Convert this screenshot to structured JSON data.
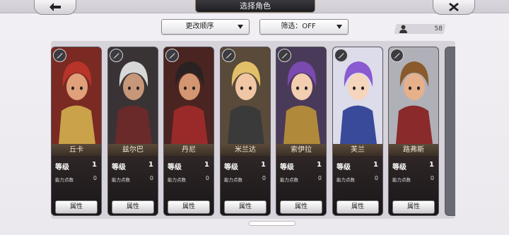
{
  "header": {
    "title": "选择角色"
  },
  "filters": {
    "sort_label": "更改顺序",
    "filter_label": "筛选：OFF"
  },
  "roster": {
    "count": "58"
  },
  "labels": {
    "level": "等级",
    "ability_points": "能力点数",
    "attribute_button": "属性"
  },
  "characters": [
    {
      "name": "丘卡",
      "level": "1",
      "points": "0",
      "class_icon": "sword-icon"
    },
    {
      "name": "兹尔巴",
      "level": "1",
      "points": "0",
      "class_icon": "sword-icon"
    },
    {
      "name": "丹尼",
      "level": "1",
      "points": "0",
      "class_icon": "sword-icon"
    },
    {
      "name": "米兰达",
      "level": "1",
      "points": "0",
      "class_icon": "sword-icon"
    },
    {
      "name": "索伊拉",
      "level": "1",
      "points": "0",
      "class_icon": "sword-icon"
    },
    {
      "name": "芙兰",
      "level": "1",
      "points": "0",
      "class_icon": "sword-icon"
    },
    {
      "name": "路弗斯",
      "level": "1",
      "points": "0",
      "class_icon": "fist-icon"
    }
  ],
  "colors": {
    "background": "#efedf1",
    "card": "#1b1a1e",
    "name_plate": "#4a3c30"
  }
}
